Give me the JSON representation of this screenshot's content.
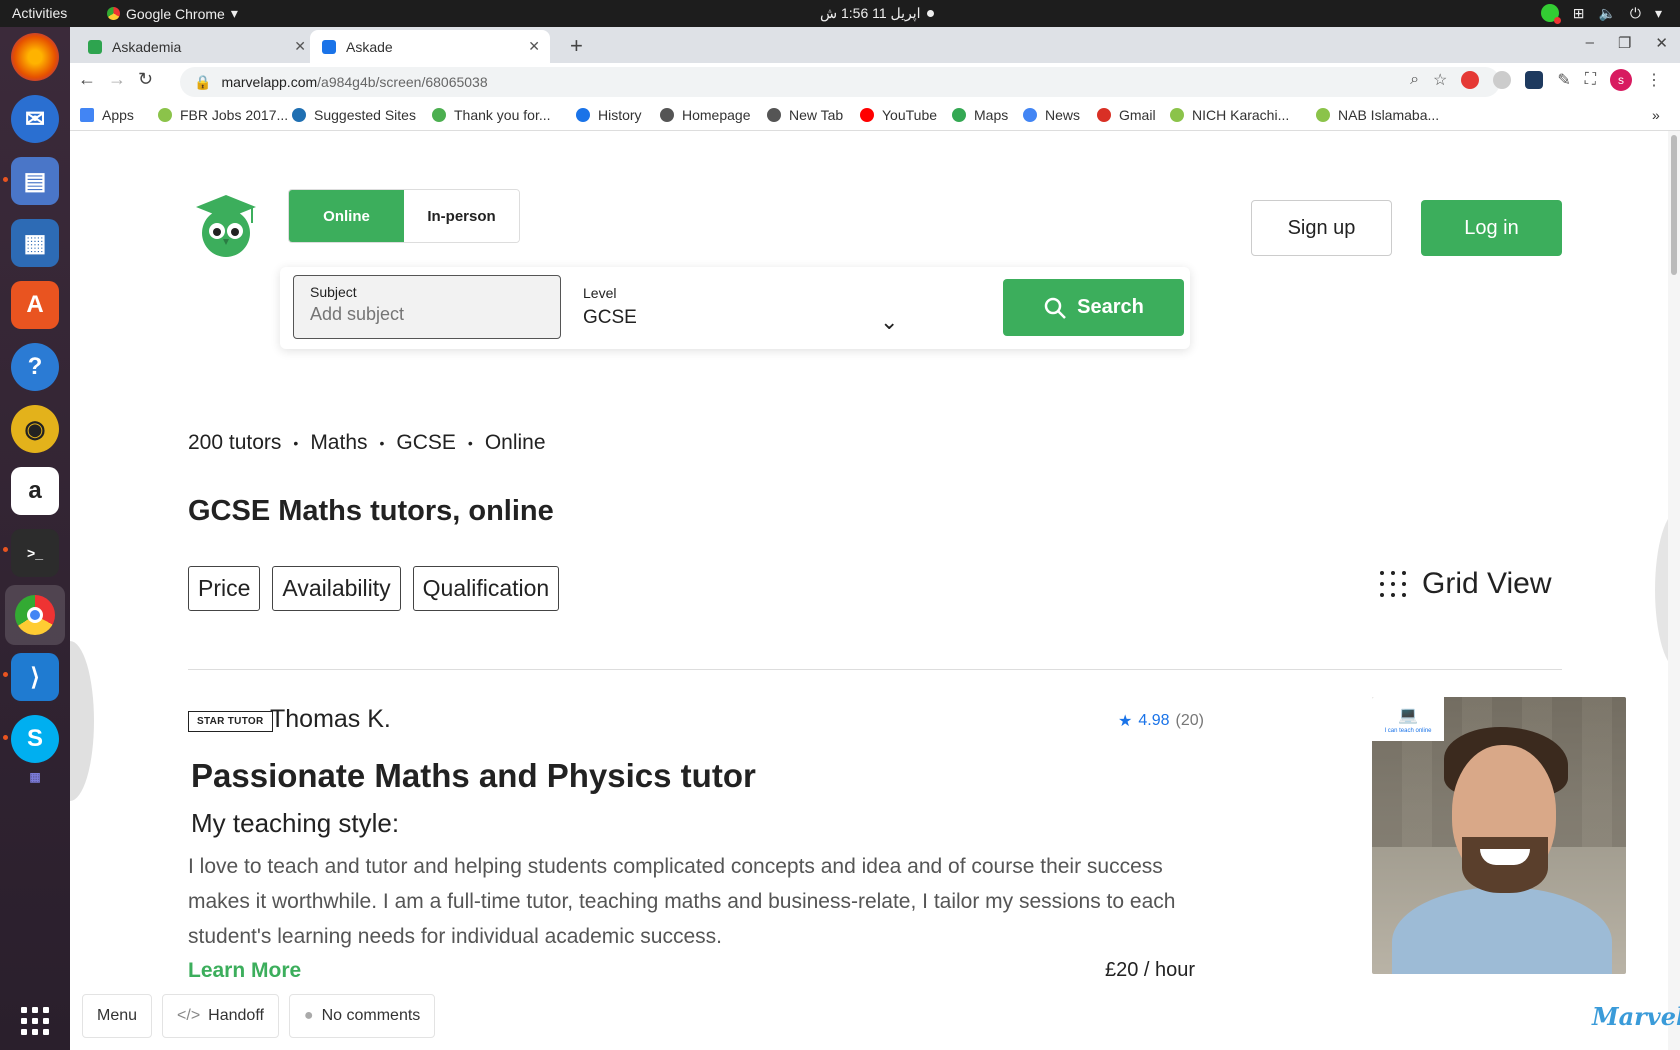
{
  "topbar": {
    "activities": "Activities",
    "app_name": "Google Chrome",
    "clock": "اپریل 11  1:56 ش"
  },
  "browser": {
    "tabs": [
      {
        "label": "Askademia",
        "icon_color": "#2ea44f"
      },
      {
        "label": "Askade",
        "icon_color": "#1a73e8"
      }
    ],
    "url_host": "marvelapp.com",
    "url_path": "/a984g4b/screen/68065038",
    "profile_initial": "s",
    "bookmarks": [
      {
        "label": "Apps",
        "icon": "apps-grid-icon",
        "color": "#4285f4"
      },
      {
        "label": "FBR Jobs 2017...",
        "icon": "j-icon",
        "color": "#8bc34a"
      },
      {
        "label": "Suggested Sites",
        "icon": "bing-icon",
        "color": "#1f6fb2"
      },
      {
        "label": "Thank you for...",
        "icon": "check-icon",
        "color": "#4caf50"
      },
      {
        "label": "History",
        "icon": "history-icon",
        "color": "#1a73e8"
      },
      {
        "label": "Homepage",
        "icon": "globe-icon",
        "color": "#555555"
      },
      {
        "label": "New Tab",
        "icon": "globe-icon",
        "color": "#555555"
      },
      {
        "label": "YouTube",
        "icon": "youtube-icon",
        "color": "#ff0000"
      },
      {
        "label": "Maps",
        "icon": "maps-icon",
        "color": "#34a853"
      },
      {
        "label": "News",
        "icon": "news-icon",
        "color": "#4285f4"
      },
      {
        "label": "Gmail",
        "icon": "gmail-icon",
        "color": "#d93025"
      },
      {
        "label": "NICH Karachi...",
        "icon": "j-icon",
        "color": "#8bc34a"
      },
      {
        "label": "NAB Islamaba...",
        "icon": "j-icon",
        "color": "#8bc34a"
      }
    ],
    "bookmarks_overflow": "»"
  },
  "site": {
    "mode_online": "Online",
    "mode_inperson": "In-person",
    "signup": "Sign up",
    "login": "Log in",
    "brand_color": "#3cae5c",
    "search": {
      "subject_label": "Subject",
      "subject_placeholder": "Add subject",
      "level_label": "Level",
      "level_value": "GCSE",
      "button": "Search"
    },
    "crumbs": [
      "200 tutors",
      "Maths",
      "GCSE",
      "Online"
    ],
    "heading": "GCSE Maths tutors, online",
    "filters": [
      "Price",
      "Availability",
      "Qualification"
    ],
    "grid_view": "Grid View",
    "tutor": {
      "badge": "STAR TUTOR",
      "name": "Thomas K.",
      "rating": "4.98",
      "reviews": "(20)",
      "title": "Passionate Maths and Physics tutor",
      "subtitle": "My teaching style:",
      "description": "I love to teach and tutor and helping students complicated concepts and idea and of course their success makes it worthwhile. I am a full-time tutor, teaching maths and business-relate, I tailor my sessions to each student's learning needs for individual academic success.",
      "learn_more": "Learn More",
      "price": "£20 / hour",
      "online_badge": "I can teach online"
    }
  },
  "marvel": {
    "menu": "Menu",
    "handoff": "Handoff",
    "comments": "No comments",
    "logo": "Marvel"
  }
}
